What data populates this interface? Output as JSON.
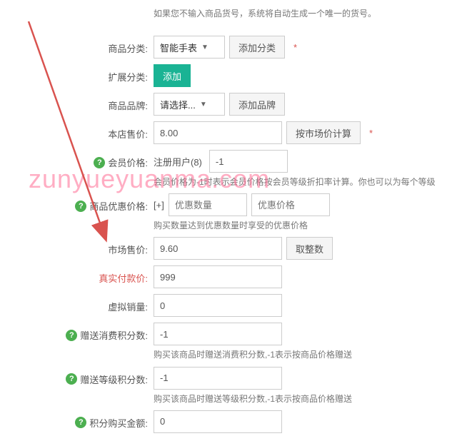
{
  "hints": {
    "sku": "如果您不输入商品货号，系统将自动生成一个唯一的货号。",
    "member_price": "会员价格为-1时表示会员价格按会员等级折扣率计算。你也可以为每个等级",
    "volume_price": "购买数量达到优惠数量时享受的优惠价格",
    "consume_points": "购买该商品时赠送消费积分数,-1表示按商品价格赠送",
    "rank_points": "购买该商品时赠送等级积分数,-1表示按商品价格赠送"
  },
  "labels": {
    "category": "商品分类:",
    "ext_category": "扩展分类:",
    "brand": "商品品牌:",
    "shop_price": "本店售价:",
    "member_price": "会员价格:",
    "volume_price": "商品优惠价格:",
    "market_price": "市场售价:",
    "real_pay": "真实付款价:",
    "virtual_sales": "虚拟销量:",
    "consume_points": "赠送消费积分数:",
    "rank_points": "赠送等级积分数:",
    "points_buy": "积分购买金额:"
  },
  "buttons": {
    "add_category": "添加分类",
    "add": "添加",
    "add_brand": "添加品牌",
    "calc_market": "按市场价计算",
    "round": "取整数",
    "plus": "[+]"
  },
  "selects": {
    "category": "智能手表",
    "brand": "请选择..."
  },
  "prefix": {
    "reg_user": "注册用户(8)"
  },
  "placeholders": {
    "volume_qty": "优惠数量",
    "volume_price": "优惠价格"
  },
  "values": {
    "shop_price": "8.00",
    "member_price": "-1",
    "market_price": "9.60",
    "real_pay": "999",
    "virtual_sales": "0",
    "consume_points": "-1",
    "rank_points": "-1",
    "points_buy": "0"
  },
  "required_mark": "*",
  "watermark": "zunyueyuanma.com"
}
